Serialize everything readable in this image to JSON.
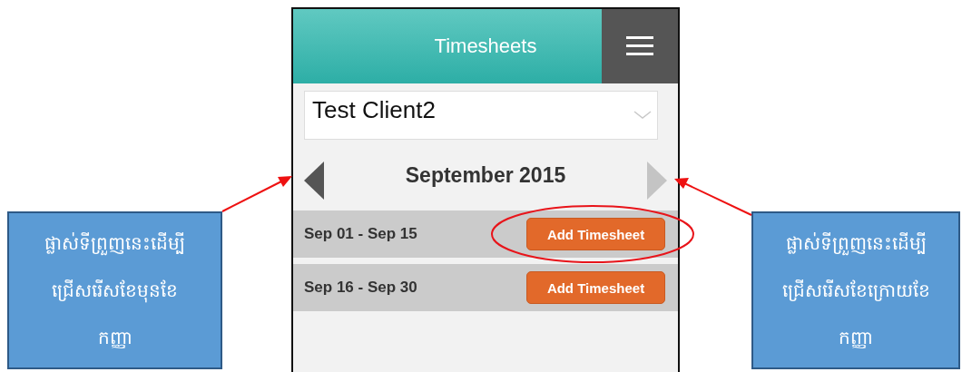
{
  "header": {
    "title": "Timesheets"
  },
  "client_select": {
    "value": "Test Client2"
  },
  "month_nav": {
    "title": "September 2015"
  },
  "periods": [
    {
      "label": "Sep 01 - Sep 15",
      "button": "Add Timesheet",
      "highlighted": true
    },
    {
      "label": "Sep 16 - Sep 30",
      "button": "Add Timesheet",
      "highlighted": false
    }
  ],
  "callouts": [
    {
      "text": "ផ្លាស់ទីព្រួញនេះដើម្បី\nជ្រើសរើសខែមុនខែ\nកញ្ញា"
    },
    {
      "text": "ផ្លាស់ទីព្រួញនេះដើម្បី\nជ្រើសរើសខែក្រោយខែ\nកញ្ញា"
    }
  ]
}
